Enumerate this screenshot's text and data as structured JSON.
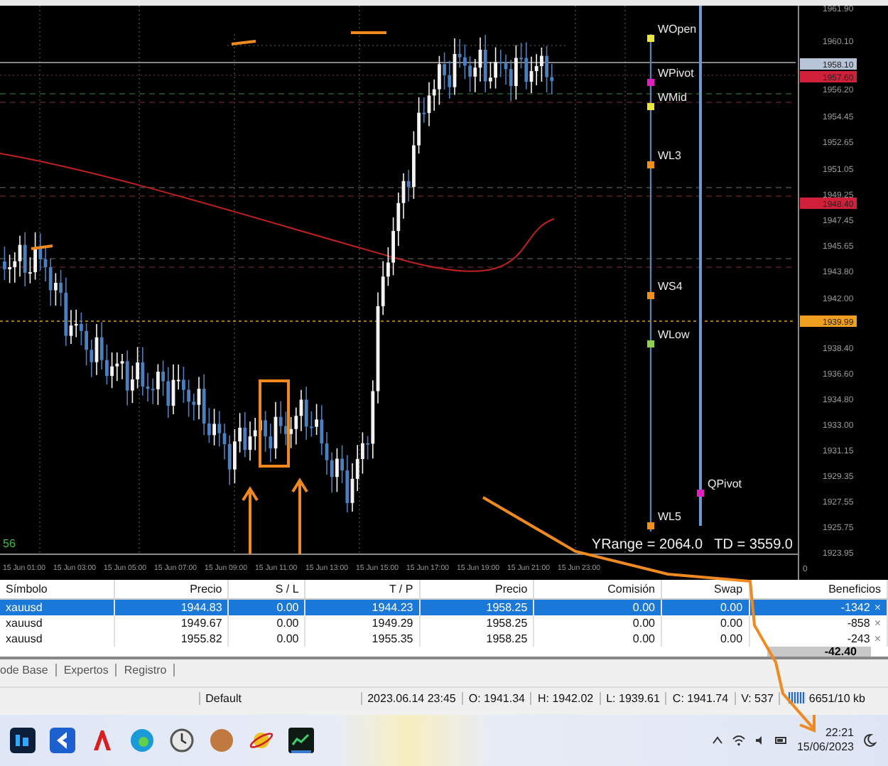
{
  "chart": {
    "price_ticks": [
      "1961.90",
      "1960.10",
      "1956.20",
      "1954.45",
      "1952.65",
      "1951.05",
      "1949.25",
      "1947.45",
      "1945.65",
      "1943.80",
      "1942.00",
      "1938.40",
      "1936.60",
      "1934.80",
      "1933.00",
      "1931.15",
      "1929.35",
      "1927.55",
      "1925.75",
      "1923.95"
    ],
    "price_tags": [
      {
        "text": "1958.10",
        "color": "#b8c4d8"
      },
      {
        "text": "1957.60",
        "color": "#d0203a"
      },
      {
        "text": "1948.40",
        "color": "#d0203a"
      },
      {
        "text": "1939.99",
        "color": "#f0a020"
      }
    ],
    "time_ticks": [
      "15 Jun 01:00",
      "15 Jun 03:00",
      "15 Jun 05:00",
      "15 Jun 07:00",
      "15 Jun 09:00",
      "15 Jun 11:00",
      "15 Jun 13:00",
      "15 Jun 15:00",
      "15 Jun 17:00",
      "15 Jun 19:00",
      "15 Jun 21:00",
      "15 Jun 23:00"
    ],
    "levels": [
      {
        "label": "WOpen",
        "color": "#e8e840"
      },
      {
        "label": "WPivot",
        "color": "#e020c0"
      },
      {
        "label": "WMid",
        "color": "#e8e840"
      },
      {
        "label": "WL3",
        "color": "#f09020"
      },
      {
        "label": "WS4",
        "color": "#f09020"
      },
      {
        "label": "WLow",
        "color": "#90d050"
      },
      {
        "label": "QPivot",
        "color": "#e020c0"
      },
      {
        "label": "WL5",
        "color": "#f09020"
      }
    ],
    "corner_value": "56",
    "range_text": "YRange = 2064.0   TD = 3559.0",
    "axis_zero": "0"
  },
  "table": {
    "columns": [
      "Símbolo",
      "Precio",
      "S / L",
      "T / P",
      "Precio",
      "Comisión",
      "Swap",
      "Beneficios"
    ],
    "rows": [
      {
        "cells": [
          "xauusd",
          "1944.83",
          "0.00",
          "1944.23",
          "1958.25",
          "0.00",
          "0.00",
          "-1342"
        ],
        "selected": true,
        "close": "×"
      },
      {
        "cells": [
          "xauusd",
          "1949.67",
          "0.00",
          "1949.29",
          "1958.25",
          "0.00",
          "0.00",
          "-858"
        ],
        "selected": false,
        "close": "×"
      },
      {
        "cells": [
          "xauusd",
          "1955.82",
          "0.00",
          "1955.35",
          "1958.25",
          "0.00",
          "0.00",
          "-243"
        ],
        "selected": false,
        "close": "×"
      }
    ],
    "total": "-42.40"
  },
  "tabs": [
    "ode Base",
    "Expertos",
    "Registro"
  ],
  "status_bar": [
    "Default",
    "2023.06.14 23:45",
    "O: 1941.34",
    "H: 1942.02",
    "L: 1939.61",
    "C: 1941.74",
    "V: 537",
    "6651/10 kb"
  ],
  "taskbar": {
    "time": "22:21",
    "date": "15/06/2023"
  }
}
